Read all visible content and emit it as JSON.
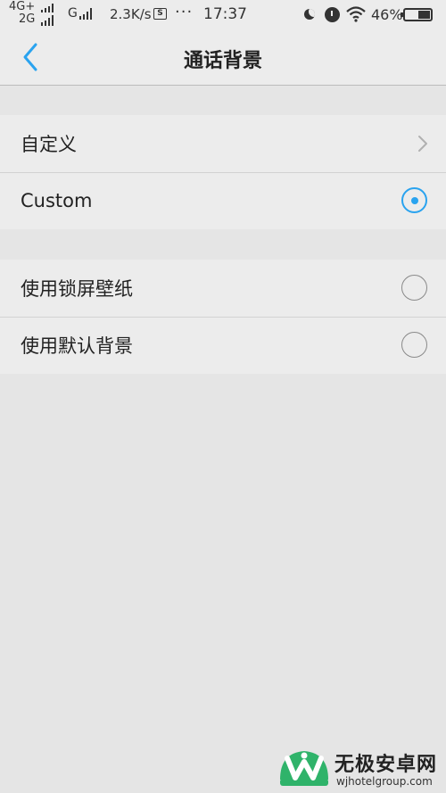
{
  "status_bar": {
    "network_top": "4G+",
    "network_bottom": "2G",
    "network2": "G",
    "speed": "2.3K/s",
    "sim_icon": "S",
    "more": "···",
    "time": "17:37",
    "battery_pct": "46%",
    "battery_level": 0.46
  },
  "header": {
    "title": "通话背景",
    "back_icon": "chevron-left-icon",
    "accent_color": "#2aa3ef"
  },
  "groups": [
    {
      "items": [
        {
          "label": "自定义",
          "control": "chevron"
        },
        {
          "label": "Custom",
          "control": "radio",
          "selected": true
        }
      ]
    },
    {
      "items": [
        {
          "label": "使用锁屏壁纸",
          "control": "radio",
          "selected": false
        },
        {
          "label": "使用默认背景",
          "control": "radio",
          "selected": false
        }
      ]
    }
  ],
  "watermark": {
    "title": "无极安卓网",
    "url": "wjhotelgroup.com"
  }
}
